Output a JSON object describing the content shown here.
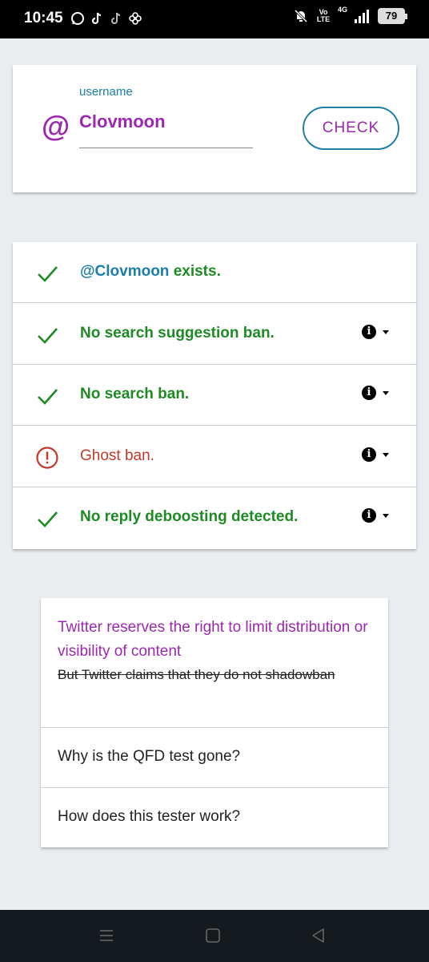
{
  "status_bar": {
    "time": "10:45",
    "apps": [
      "whatsapp-icon",
      "tiktok-icon",
      "tiktok-icon",
      "pinwheel-icon"
    ],
    "volte": "Vo LTE",
    "network": "4G",
    "battery": "79"
  },
  "username_card": {
    "at_symbol": "@",
    "label": "username",
    "value": "Clovmoon",
    "check_button": "CHECK"
  },
  "results": [
    {
      "handle": "@Clovmoon",
      "text": " exists.",
      "status": "ok",
      "info": false
    },
    {
      "handle": "",
      "text": "No search suggestion ban.",
      "status": "ok",
      "info": true
    },
    {
      "handle": "",
      "text": "No search ban.",
      "status": "ok",
      "info": true
    },
    {
      "handle": "",
      "text": "Ghost ban.",
      "status": "ban",
      "info": true
    },
    {
      "handle": "",
      "text": "No reply deboosting detected.",
      "status": "ok",
      "info": true
    }
  ],
  "faq": {
    "highlight": "Twitter reserves the right to limit distribution or visibility of content",
    "struck": "But Twitter claims that they do not shadowban",
    "items": [
      "Why is the QFD test gone?",
      "How does this tester work?"
    ]
  },
  "colors": {
    "ok": "#1e8a23",
    "ban": "#c0392b",
    "accent_purple": "#9c27b0",
    "accent_blue": "#1a7fa8"
  }
}
